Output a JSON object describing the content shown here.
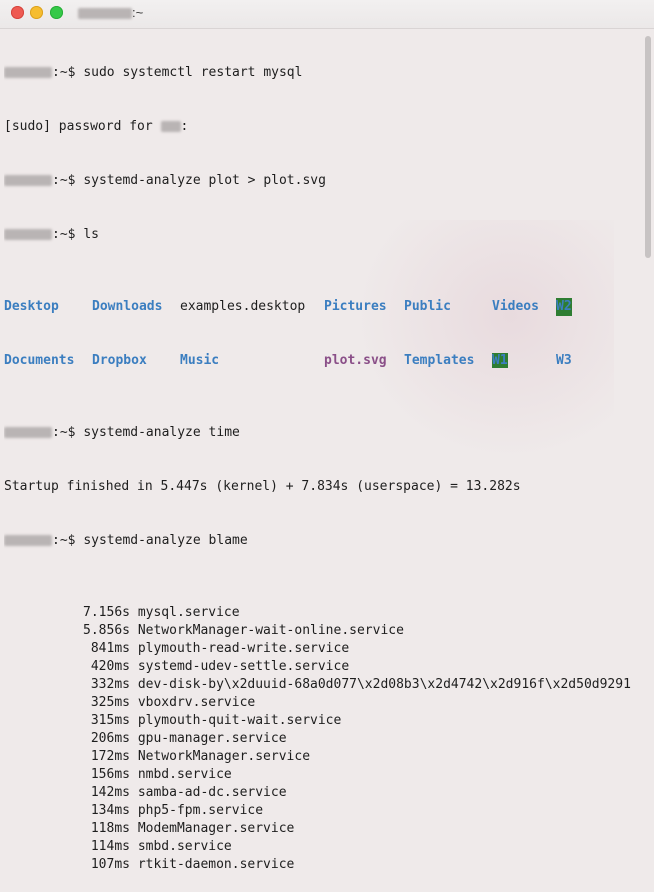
{
  "window": {
    "title_suffix": ":~"
  },
  "terminal": {
    "lines": [
      {
        "prompt": ":~$ ",
        "cmd": "sudo systemctl restart mysql"
      },
      {
        "text": "[sudo] password for ",
        "tail": ":"
      },
      {
        "prompt": ":~$ ",
        "cmd": "systemd-analyze plot > plot.svg"
      },
      {
        "prompt": ":~$ ",
        "cmd": "ls"
      }
    ],
    "ls_row1": [
      "Desktop",
      "Downloads",
      "examples.desktop",
      "Pictures",
      "Public",
      "Videos",
      "W2"
    ],
    "ls_row2": [
      "Documents",
      "Dropbox",
      "Music",
      "plot.svg",
      "Templates",
      "W1",
      "W3"
    ],
    "time_cmd": {
      "prompt": ":~$ ",
      "cmd": "systemd-analyze time"
    },
    "startup": "Startup finished in 5.447s (kernel) + 7.834s (userspace) = 13.282s",
    "blame_cmd": {
      "prompt": ":~$ ",
      "cmd": "systemd-analyze blame"
    },
    "blame": [
      {
        "time": "7.156s",
        "unit": "mysql.service"
      },
      {
        "time": "5.856s",
        "unit": "NetworkManager-wait-online.service"
      },
      {
        "time": "841ms",
        "unit": "plymouth-read-write.service"
      },
      {
        "time": "420ms",
        "unit": "systemd-udev-settle.service"
      },
      {
        "time": "332ms",
        "unit": "dev-disk-by\\x2duuid-68a0d077\\x2d08b3\\x2d4742\\x2d916f\\x2d50d9291"
      },
      {
        "time": "325ms",
        "unit": "vboxdrv.service"
      },
      {
        "time": "315ms",
        "unit": "plymouth-quit-wait.service"
      },
      {
        "time": "206ms",
        "unit": "gpu-manager.service"
      },
      {
        "time": "172ms",
        "unit": "NetworkManager.service"
      },
      {
        "time": "156ms",
        "unit": "nmbd.service"
      },
      {
        "time": "142ms",
        "unit": "samba-ad-dc.service"
      },
      {
        "time": "134ms",
        "unit": "php5-fpm.service"
      },
      {
        "time": "118ms",
        "unit": "ModemManager.service"
      },
      {
        "time": "114ms",
        "unit": "smbd.service"
      },
      {
        "time": "107ms",
        "unit": "rtkit-daemon.service"
      }
    ]
  }
}
